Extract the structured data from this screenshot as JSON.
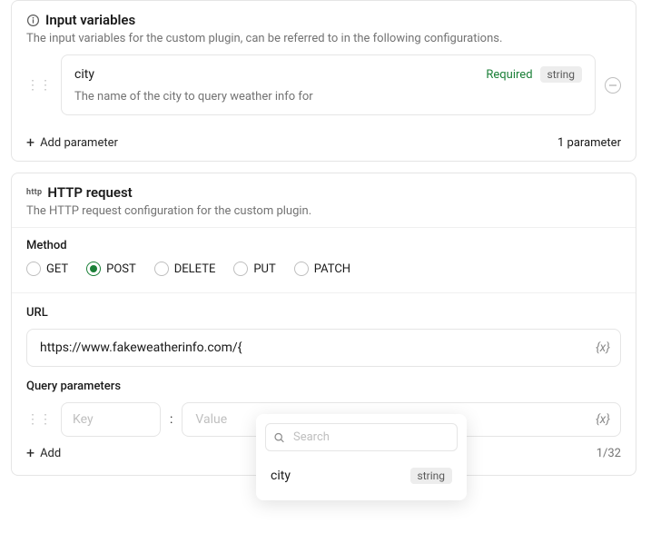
{
  "input_vars": {
    "title": "Input variables",
    "desc": "The input variables for the custom plugin, can be referred to in the following configurations.",
    "params": [
      {
        "name": "city",
        "required": "Required",
        "type": "string",
        "desc": "The name of the city to query weather info for"
      }
    ],
    "add_label": "Add parameter",
    "count_label": "1 parameter"
  },
  "http": {
    "title": "HTTP request",
    "desc": "The HTTP request configuration for the custom plugin.",
    "method_label": "Method",
    "methods": {
      "get": "GET",
      "post": "POST",
      "delete": "DELETE",
      "put": "PUT",
      "patch": "PATCH"
    },
    "url_label": "URL",
    "url_value": "https://www.fakeweatherinfo.com/{",
    "query_label": "Query parameters",
    "key_placeholder": "Key",
    "value_placeholder": "Value",
    "add_label": "Add",
    "qp_count": "1/32",
    "var_icon": "{x}"
  },
  "popover": {
    "search_placeholder": "Search",
    "item_name": "city",
    "item_type": "string"
  },
  "icons": {
    "http_tag": "http"
  }
}
